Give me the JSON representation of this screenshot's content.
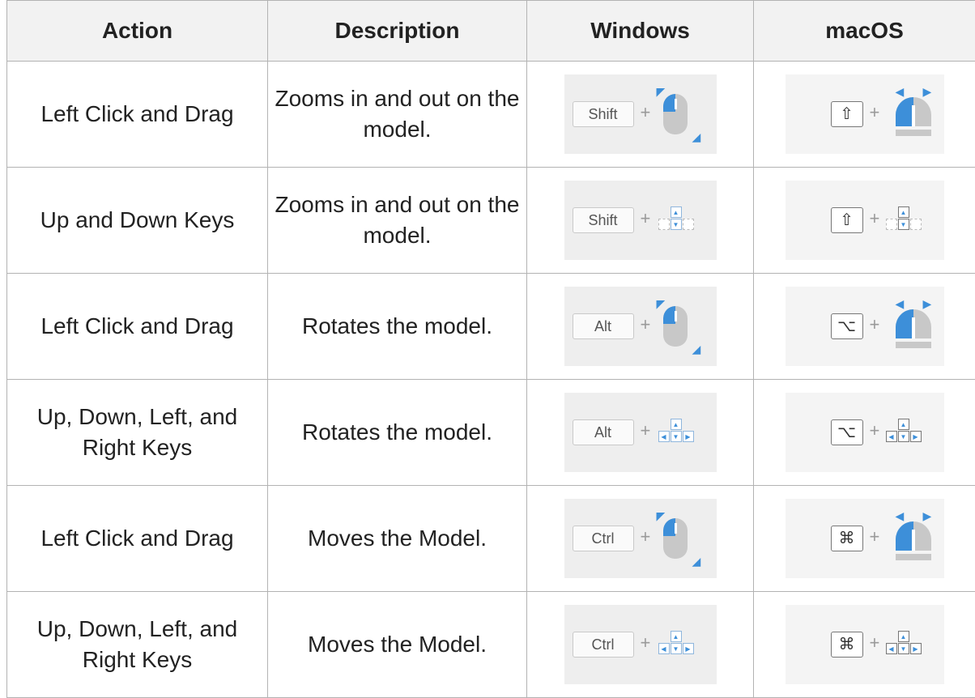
{
  "headers": [
    "Action",
    "Description",
    "Windows",
    "macOS"
  ],
  "rows": [
    {
      "action": "Left Click and Drag",
      "description": "Zooms in and out on the model.",
      "win_key": "Shift",
      "mac_key": "⇧",
      "input": "mouse-drag"
    },
    {
      "action": "Up and Down Keys",
      "description": "Zooms in and out on the model.",
      "win_key": "Shift",
      "mac_key": "⇧",
      "input": "up-down-keys"
    },
    {
      "action": "Left Click and Drag",
      "description": "Rotates the model.",
      "win_key": "Alt",
      "mac_key": "⌥",
      "input": "mouse-drag"
    },
    {
      "action": "Up, Down, Left, and Right Keys",
      "description": "Rotates the model.",
      "win_key": "Alt",
      "mac_key": "⌥",
      "input": "arrow-keys"
    },
    {
      "action": "Left Click and Drag",
      "description": "Moves the Model.",
      "win_key": "Ctrl",
      "mac_key": "⌘",
      "input": "mouse-drag"
    },
    {
      "action": "Up, Down, Left, and Right Keys",
      "description": "Moves the Model.",
      "win_key": "Ctrl",
      "mac_key": "⌘",
      "input": "arrow-keys"
    }
  ],
  "plus_sign": "+",
  "colors": {
    "accent": "#3d8fd9",
    "border": "#b3b3b3",
    "header_bg": "#f2f2f2"
  }
}
